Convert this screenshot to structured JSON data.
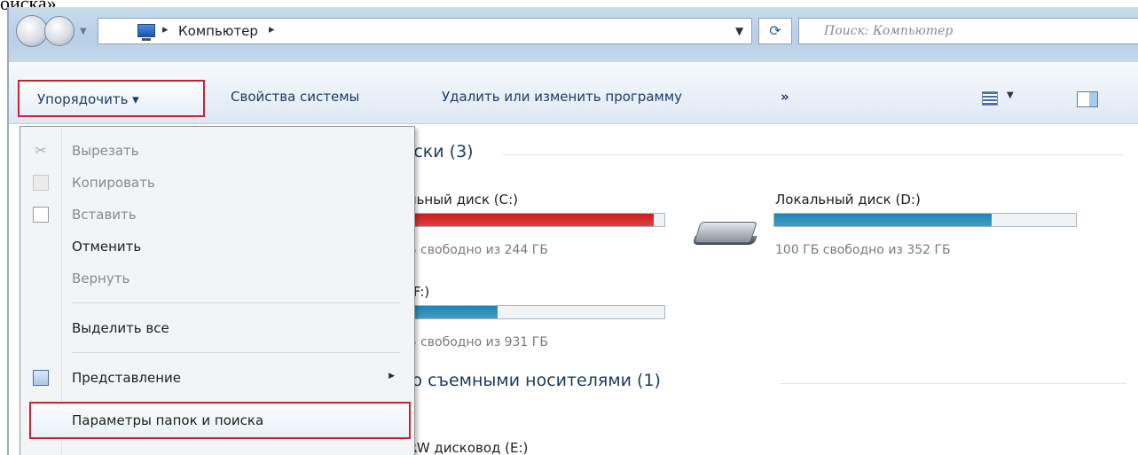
{
  "top_text": "оиска»",
  "address_bar": {
    "breadcrumb": "Компьютер",
    "search_placeholder": "Поиск: Компьютер"
  },
  "toolbar": {
    "organize": "Упорядочить ▾",
    "system_properties": "Свойства системы",
    "uninstall": "Удалить или изменить программу",
    "more": "»"
  },
  "content": {
    "hdd_group": "иски (3)",
    "removable_group": "со съемными носителями (1)",
    "drives": [
      {
        "name": "льный диск (C:)",
        "free": "Б свободно из 244 ГБ",
        "used_fraction": 0.96,
        "color": "#d01a1a"
      },
      {
        "name": "Локальный диск (D:)",
        "free": "100 ГБ свободно из 352 ГБ",
        "used_fraction": 0.72,
        "color": "#1c86b4"
      },
      {
        "name": "(F:)",
        "free": "Б свободно из 931 ГБ",
        "used_fraction": 0.37,
        "color": "#1c86b4"
      }
    ],
    "rw_drive": "RW дисковод (E:)"
  },
  "menu": {
    "items": [
      {
        "label": "Вырезать",
        "disabled": true,
        "icon": "scissors-icon"
      },
      {
        "label": "Копировать",
        "disabled": true,
        "icon": "copy-icon"
      },
      {
        "label": "Вставить",
        "disabled": true,
        "icon": "paste-icon"
      },
      {
        "label": "Отменить",
        "disabled": false
      },
      {
        "label": "Вернуть",
        "disabled": true
      },
      {
        "label": "Выделить все",
        "disabled": false
      },
      {
        "label": "Представление",
        "disabled": false,
        "icon": "view-icon",
        "has_submenu": true
      },
      {
        "label": "Параметры папок и поиска",
        "disabled": false,
        "highlighted": true
      }
    ]
  },
  "colors": {
    "highlight_border": "#c8232c",
    "c_drive_fill": "#d01a1a",
    "drive_fill": "#1c86b4"
  }
}
